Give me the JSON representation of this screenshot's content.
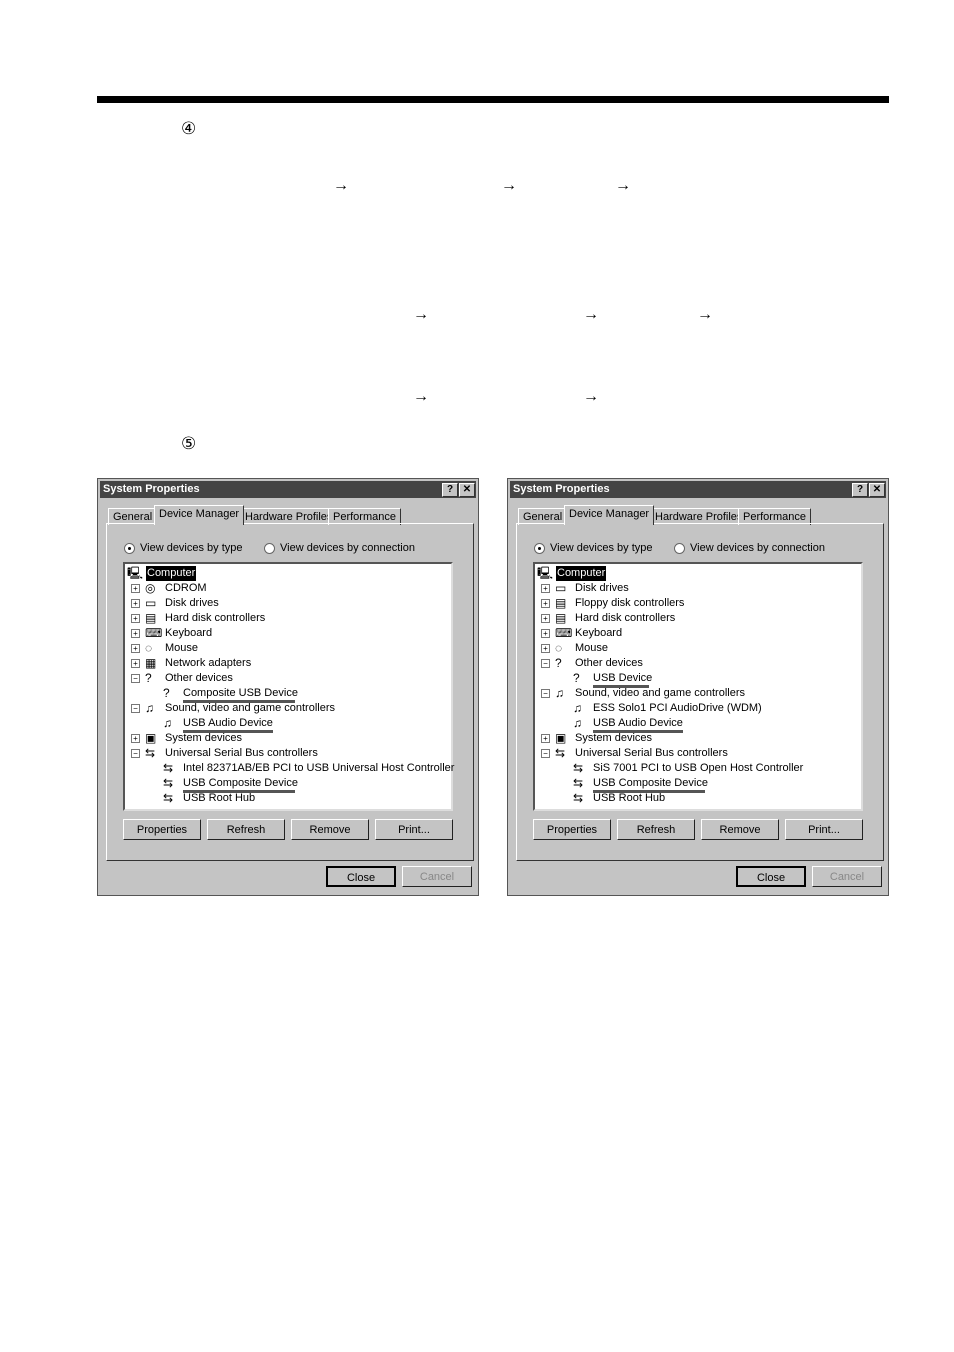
{
  "document": {
    "steps": [
      "④",
      "⑤"
    ],
    "arrow": "→"
  },
  "dialogs": [
    {
      "title": "System Properties",
      "help_button": "?",
      "close_button": "✕",
      "tabs": [
        "General",
        "Device Manager",
        "Hardware Profiles",
        "Performance"
      ],
      "active_tab": 1,
      "radios": [
        {
          "label": "View devices by type",
          "checked": true
        },
        {
          "label": "View devices by connection",
          "checked": false
        }
      ],
      "tree": [
        {
          "level": 0,
          "icon": "computer-icon",
          "label": "Computer",
          "selected": true
        },
        {
          "level": 1,
          "expander": "+",
          "icon": "cdrom-icon",
          "label": "CDROM"
        },
        {
          "level": 1,
          "expander": "+",
          "icon": "disk-drive-icon",
          "label": "Disk drives"
        },
        {
          "level": 1,
          "expander": "+",
          "icon": "hard-disk-controller-icon",
          "label": "Hard disk controllers"
        },
        {
          "level": 1,
          "expander": "+",
          "icon": "keyboard-icon",
          "label": "Keyboard"
        },
        {
          "level": 1,
          "expander": "+",
          "icon": "mouse-icon",
          "label": "Mouse"
        },
        {
          "level": 1,
          "expander": "+",
          "icon": "network-adapter-icon",
          "label": "Network adapters"
        },
        {
          "level": 1,
          "expander": "-",
          "icon": "question-icon",
          "label": "Other devices"
        },
        {
          "level": 2,
          "icon": "question-icon",
          "label": "Composite USB Device",
          "underlined": true
        },
        {
          "level": 1,
          "expander": "-",
          "icon": "sound-icon",
          "label": "Sound, video and game controllers"
        },
        {
          "level": 2,
          "icon": "sound-icon",
          "label": "USB Audio Device",
          "underlined": true
        },
        {
          "level": 1,
          "expander": "+",
          "icon": "system-device-icon",
          "label": "System devices"
        },
        {
          "level": 1,
          "expander": "-",
          "icon": "usb-icon",
          "label": "Universal Serial Bus controllers"
        },
        {
          "level": 2,
          "icon": "usb-icon",
          "label": "Intel 82371AB/EB PCI to USB Universal Host Controller"
        },
        {
          "level": 2,
          "icon": "usb-icon",
          "label": "USB Composite Device",
          "underlined": true
        },
        {
          "level": 2,
          "icon": "usb-icon",
          "label": "USB Root Hub"
        }
      ],
      "buttons": [
        "Properties",
        "Refresh",
        "Remove",
        "Print..."
      ],
      "close_label": "Close",
      "cancel_label": "Cancel"
    },
    {
      "title": "System Properties",
      "help_button": "?",
      "close_button": "✕",
      "tabs": [
        "General",
        "Device Manager",
        "Hardware Profiles",
        "Performance"
      ],
      "active_tab": 1,
      "radios": [
        {
          "label": "View devices by type",
          "checked": true
        },
        {
          "label": "View devices by connection",
          "checked": false
        }
      ],
      "tree": [
        {
          "level": 0,
          "icon": "computer-icon",
          "label": "Computer",
          "selected": true
        },
        {
          "level": 1,
          "expander": "+",
          "icon": "disk-drive-icon",
          "label": "Disk drives"
        },
        {
          "level": 1,
          "expander": "+",
          "icon": "floppy-controller-icon",
          "label": "Floppy disk controllers"
        },
        {
          "level": 1,
          "expander": "+",
          "icon": "hard-disk-controller-icon",
          "label": "Hard disk controllers"
        },
        {
          "level": 1,
          "expander": "+",
          "icon": "keyboard-icon",
          "label": "Keyboard"
        },
        {
          "level": 1,
          "expander": "+",
          "icon": "mouse-icon",
          "label": "Mouse"
        },
        {
          "level": 1,
          "expander": "-",
          "icon": "question-icon",
          "label": "Other devices"
        },
        {
          "level": 2,
          "icon": "question-icon",
          "label": "USB Device",
          "underlined": true
        },
        {
          "level": 1,
          "expander": "-",
          "icon": "sound-icon",
          "label": "Sound, video and game controllers"
        },
        {
          "level": 2,
          "icon": "sound-icon",
          "label": "ESS Solo1 PCI AudioDrive (WDM)"
        },
        {
          "level": 2,
          "icon": "sound-icon",
          "label": "USB Audio Device",
          "underlined": true
        },
        {
          "level": 1,
          "expander": "+",
          "icon": "system-device-icon",
          "label": "System devices"
        },
        {
          "level": 1,
          "expander": "-",
          "icon": "usb-icon",
          "label": "Universal Serial Bus controllers"
        },
        {
          "level": 2,
          "icon": "usb-icon",
          "label": "SiS 7001 PCI to USB Open Host Controller"
        },
        {
          "level": 2,
          "icon": "usb-icon",
          "label": "USB Composite Device",
          "underlined": true
        },
        {
          "level": 2,
          "icon": "usb-icon",
          "label": "USB Root Hub"
        }
      ],
      "buttons": [
        "Properties",
        "Refresh",
        "Remove",
        "Print..."
      ],
      "close_label": "Close",
      "cancel_label": "Cancel"
    }
  ]
}
